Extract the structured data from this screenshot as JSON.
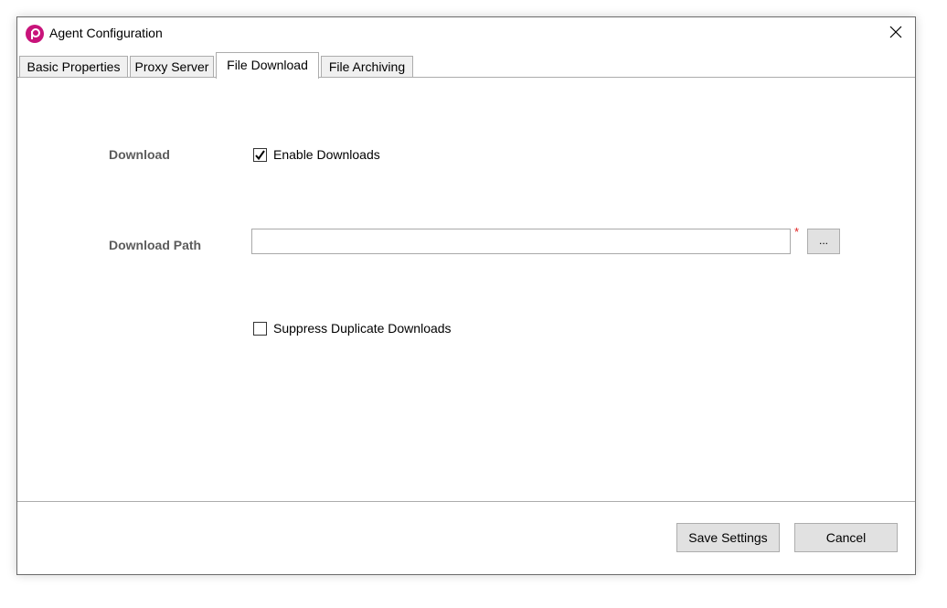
{
  "window": {
    "title": "Agent Configuration",
    "logo_icon": "app-logo-icon",
    "close_icon": "close-icon"
  },
  "tabs": [
    {
      "label": "Basic Properties",
      "active": false
    },
    {
      "label": "Proxy Server",
      "active": false
    },
    {
      "label": "File Download",
      "active": true
    },
    {
      "label": "File Archiving",
      "active": false
    }
  ],
  "file_download": {
    "download_label": "Download",
    "enable_downloads": {
      "label": "Enable Downloads",
      "checked": true
    },
    "download_path_label": "Download Path",
    "download_path_value": "",
    "required_marker": "*",
    "browse_label": "...",
    "suppress_duplicates": {
      "label": "Suppress Duplicate Downloads",
      "checked": false
    }
  },
  "footer": {
    "save_label": "Save Settings",
    "cancel_label": "Cancel"
  },
  "colors": {
    "brand": "#c8137a",
    "required": "#e02020",
    "label": "#5c5c5c"
  }
}
